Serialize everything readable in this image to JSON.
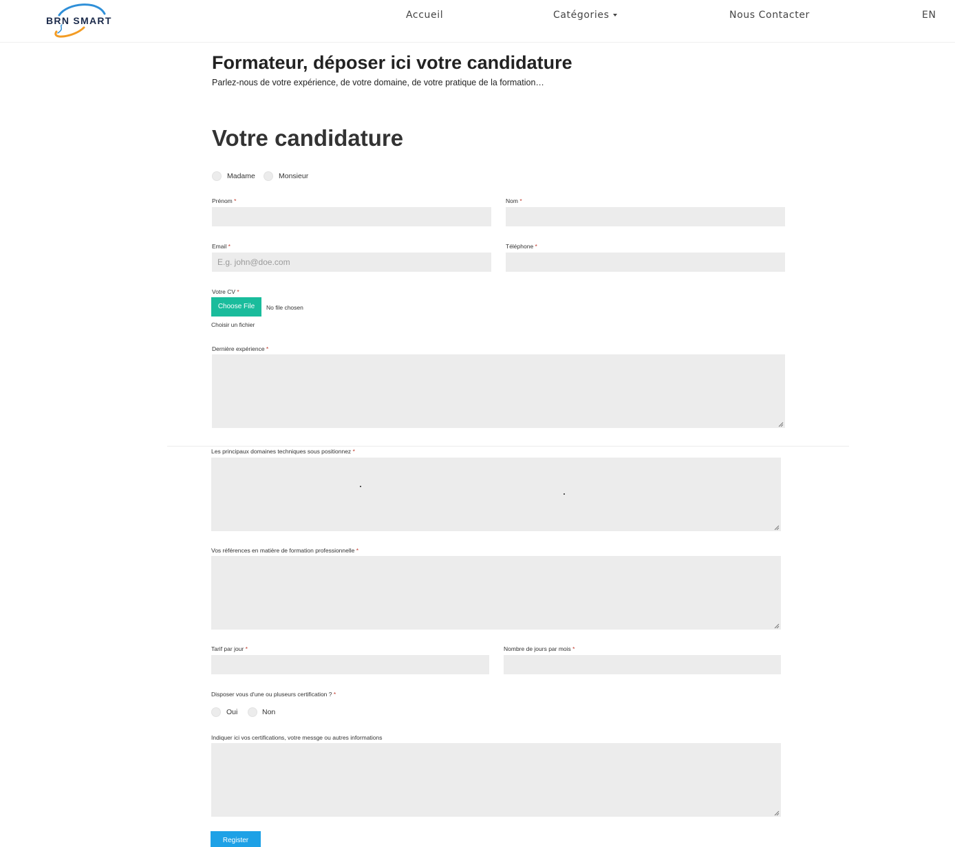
{
  "brand": {
    "name": "BRN SMART",
    "accent_blue": "#2f8fd8",
    "accent_orange": "#f39c24"
  },
  "nav": {
    "home": "Accueil",
    "categories": "Catégories",
    "contact": "Nous Contacter",
    "language": "EN"
  },
  "page": {
    "title": "Formateur, déposer ici votre candidature",
    "subtitle": "Parlez-nous de votre expérience, de votre domaine, de votre pratique de la formation…",
    "section_title": "Votre candidature"
  },
  "form": {
    "civility": {
      "option_1": "Madame",
      "option_2": "Monsieur"
    },
    "required_mark": "*",
    "first_name_label": "Prénom",
    "last_name_label": "Nom",
    "email_label": "Email",
    "email_placeholder": "E.g. john@doe.com",
    "phone_label": "Téléphone",
    "cv_label": "Votre CV",
    "cv_button": "Choose File",
    "cv_status": "No file chosen",
    "cv_hint": "Choisir un fichier",
    "last_experience_label": "Dernière expérience",
    "domains_label": "Les principaux domaines techniques sous positionnez",
    "references_label": "Vos références en matière de formation professionnelle",
    "daily_rate_label": "Tarif par jour",
    "days_per_month_label": "Nombre de jours par mois",
    "certification_question": "Disposer vous d'une ou pluseurs certification ?",
    "certification": {
      "yes": "Oui",
      "no": "Non"
    },
    "message_label": "Indiquer ici vos certifications, votre messge ou autres informations",
    "submit": "Register"
  },
  "colors": {
    "file_button": "#1abc9c",
    "submit_button": "#1ea1e6",
    "field_background": "#ececec"
  }
}
